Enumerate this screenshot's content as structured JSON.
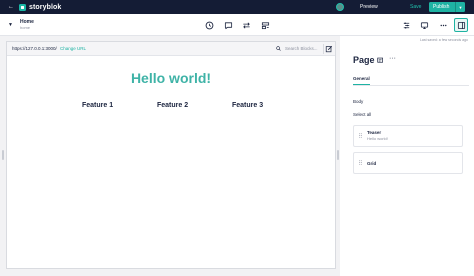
{
  "app": {
    "brand": "storyblok",
    "back_icon": "arrow-left-icon",
    "logo_icon": "storyblok-logo-icon"
  },
  "topbar": {
    "preview_label": "Preview",
    "save_label": "Save",
    "publish_label": "Publish",
    "publish_menu_icon": "chevron-down-icon",
    "avatar_icon": "user-avatar-icon"
  },
  "story": {
    "title": "Home",
    "subtitle": "home",
    "expand_icon": "chevron-down-icon"
  },
  "toolbar": {
    "center_tools": [
      "history-icon",
      "comments-icon",
      "swap-icon",
      "layout-icon"
    ],
    "right_tools": [
      "settings-icon",
      "preview-screen-icon",
      "more-icon",
      "sidebar-toggle-icon"
    ]
  },
  "preview": {
    "url": "https://127.0.0.1:3000/",
    "change_url_label": "Change URL",
    "search_placeholder": "Search Blocks...",
    "heading": "Hello world!",
    "features": [
      "Feature 1",
      "Feature 2",
      "Feature 3"
    ]
  },
  "panel": {
    "last_saved": "Last saved: a few seconds ago",
    "title": "Page",
    "tabs": [
      {
        "label": "General"
      }
    ],
    "field_label": "Body",
    "select_all_label": "Select all",
    "blocks": [
      {
        "name": "Teaser",
        "subtitle": "Hello world!"
      },
      {
        "name": "Grid",
        "subtitle": ""
      }
    ]
  },
  "colors": {
    "topbar_bg": "#141c35",
    "accent": "#1eb3a3",
    "heading": "#3fb3a7",
    "text": "#1b243f",
    "muted": "#8d919f"
  }
}
